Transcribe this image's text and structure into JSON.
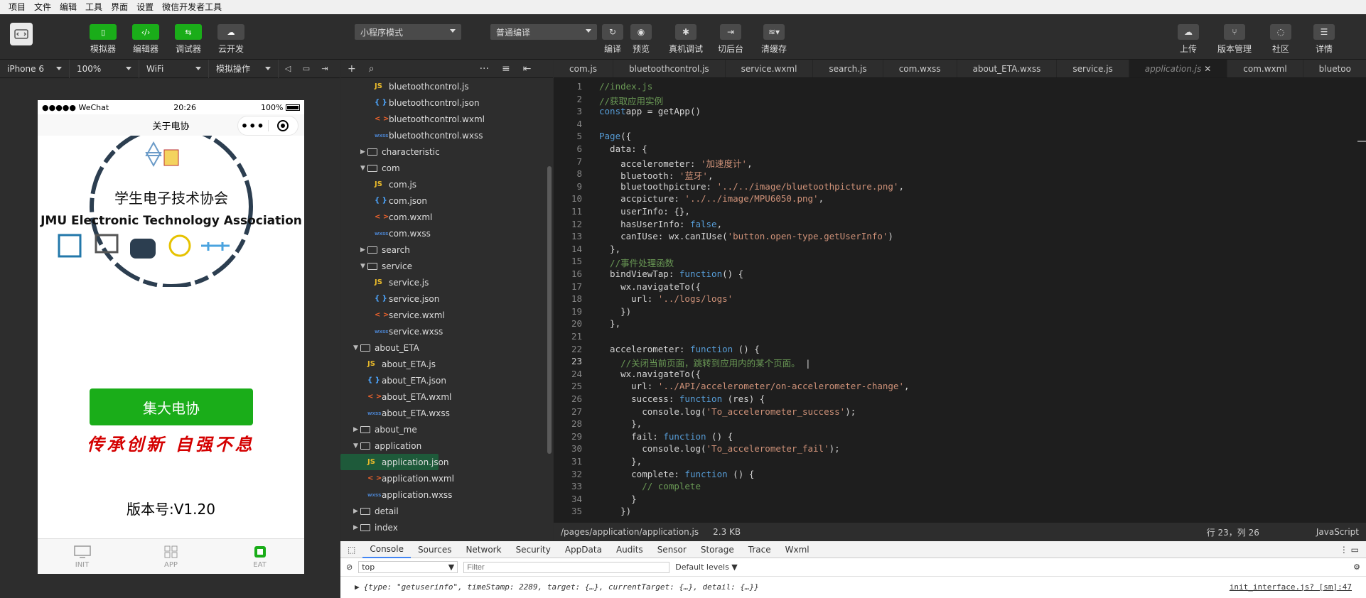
{
  "menu": [
    "项目",
    "文件",
    "编辑",
    "工具",
    "界面",
    "设置",
    "微信开发者工具"
  ],
  "toolbar": {
    "buttons": [
      {
        "label": "模拟器",
        "icon": "phone-icon"
      },
      {
        "label": "编辑器",
        "icon": "code-icon"
      },
      {
        "label": "调试器",
        "icon": "debug-icon"
      },
      {
        "label": "云开发",
        "icon": "cloud-icon"
      }
    ],
    "mode_select": "小程序模式",
    "compile_select": "普通编译",
    "actions": [
      "编译",
      "预览",
      "真机调试",
      "切后台",
      "清缓存"
    ],
    "right": [
      "上传",
      "版本管理",
      "社区",
      "详情"
    ]
  },
  "simbar": {
    "device": "iPhone 6",
    "zoom": "100%",
    "network": "WiFi",
    "op": "模拟操作"
  },
  "phone": {
    "carrier": "●●●●● WeChat",
    "time": "20:26",
    "battery": "100%",
    "nav_title": "关于电协",
    "logo_cn": "学生电子技术协会",
    "logo_en": "JMU  Electronic Technology Association",
    "main_button": "集大电协",
    "slogan": "传承创新 自强不息",
    "version": "版本号:V1.20",
    "tabs": [
      {
        "label": "INIT"
      },
      {
        "label": "APP"
      },
      {
        "label": "EAT"
      }
    ]
  },
  "tree": [
    {
      "t": "js",
      "name": "bluetoothcontrol.js",
      "d": 2
    },
    {
      "t": "json",
      "name": "bluetoothcontrol.json",
      "d": 2
    },
    {
      "t": "wxml",
      "name": "bluetoothcontrol.wxml",
      "d": 2
    },
    {
      "t": "wxss",
      "name": "bluetoothcontrol.wxss",
      "d": 2
    },
    {
      "t": "folder",
      "name": "characteristic",
      "d": 1,
      "open": false
    },
    {
      "t": "folder",
      "name": "com",
      "d": 1,
      "open": true
    },
    {
      "t": "js",
      "name": "com.js",
      "d": 2
    },
    {
      "t": "json",
      "name": "com.json",
      "d": 2
    },
    {
      "t": "wxml",
      "name": "com.wxml",
      "d": 2
    },
    {
      "t": "wxss",
      "name": "com.wxss",
      "d": 2
    },
    {
      "t": "folder",
      "name": "search",
      "d": 1,
      "open": false
    },
    {
      "t": "folder",
      "name": "service",
      "d": 1,
      "open": true
    },
    {
      "t": "js",
      "name": "service.js",
      "d": 2
    },
    {
      "t": "json",
      "name": "service.json",
      "d": 2
    },
    {
      "t": "wxml",
      "name": "service.wxml",
      "d": 2
    },
    {
      "t": "wxss",
      "name": "service.wxss",
      "d": 2
    },
    {
      "t": "folder",
      "name": "about_ETA",
      "d": 0,
      "open": true
    },
    {
      "t": "js",
      "name": "about_ETA.js",
      "d": 1
    },
    {
      "t": "json",
      "name": "about_ETA.json",
      "d": 1
    },
    {
      "t": "wxml",
      "name": "about_ETA.wxml",
      "d": 1
    },
    {
      "t": "wxss",
      "name": "about_ETA.wxss",
      "d": 1
    },
    {
      "t": "folder",
      "name": "about_me",
      "d": 0,
      "open": false
    },
    {
      "t": "folder",
      "name": "application",
      "d": 0,
      "open": true
    },
    {
      "t": "js",
      "name": "application.js",
      "d": 1,
      "sel": true
    },
    {
      "t": "json",
      "name": "application.json",
      "d": 1
    },
    {
      "t": "wxml",
      "name": "application.wxml",
      "d": 1
    },
    {
      "t": "wxss",
      "name": "application.wxss",
      "d": 1
    },
    {
      "t": "folder",
      "name": "detail",
      "d": 0,
      "open": false
    },
    {
      "t": "folder",
      "name": "index",
      "d": 0,
      "open": false
    }
  ],
  "icons": {
    "js": "JS",
    "json": "{ }",
    "wxml": "< >",
    "wxss": "wxss"
  },
  "editor_tabs": [
    "com.js",
    "bluetoothcontrol.js",
    "service.wxml",
    "search.js",
    "com.wxss",
    "about_ETA.wxss",
    "service.js",
    "application.js",
    "com.wxml",
    "bluetoo"
  ],
  "active_tab": "application.js",
  "code": [
    [
      [
        "c-com",
        "//index.js"
      ]
    ],
    [
      [
        "c-com",
        "//获取应用实例"
      ]
    ],
    [
      [
        "c-kw",
        "const"
      ],
      [
        "",
        "app = getApp()"
      ]
    ],
    [],
    [
      [
        "c-kw",
        "Page"
      ],
      [
        "",
        "({"
      ]
    ],
    [
      [
        "",
        "  data: {"
      ]
    ],
    [
      [
        "",
        "    accelerometer: "
      ],
      [
        "c-str",
        "'加速度计'"
      ],
      [
        "",
        ","
      ]
    ],
    [
      [
        "",
        "    bluetooth: "
      ],
      [
        "c-str",
        "'蓝牙'"
      ],
      [
        "",
        ","
      ]
    ],
    [
      [
        "",
        "    bluetoothpicture: "
      ],
      [
        "c-str",
        "'../../image/bluetoothpicture.png'"
      ],
      [
        "",
        ","
      ]
    ],
    [
      [
        "",
        "    accpicture: "
      ],
      [
        "c-str",
        "'../../image/MPU6050.png'"
      ],
      [
        "",
        ","
      ]
    ],
    [
      [
        "",
        "    userInfo: {},"
      ]
    ],
    [
      [
        "",
        "    hasUserInfo: "
      ],
      [
        "c-kw",
        "false"
      ],
      [
        "",
        ","
      ]
    ],
    [
      [
        "",
        "    canIUse: wx.canIUse("
      ],
      [
        "c-str",
        "'button.open-type.getUserInfo'"
      ],
      [
        "",
        ")"
      ]
    ],
    [
      [
        "",
        "  },"
      ]
    ],
    [
      [
        "c-com",
        "  //事件处理函数"
      ]
    ],
    [
      [
        "",
        "  bindViewTap: "
      ],
      [
        "c-kw",
        "function"
      ],
      [
        "",
        "() {"
      ]
    ],
    [
      [
        "",
        "    wx.navigateTo({"
      ]
    ],
    [
      [
        "",
        "      url: "
      ],
      [
        "c-str",
        "'../logs/logs'"
      ]
    ],
    [
      [
        "",
        "    })"
      ]
    ],
    [
      [
        "",
        "  },"
      ]
    ],
    [],
    [
      [
        "",
        "  accelerometer: "
      ],
      [
        "c-kw",
        "function"
      ],
      [
        "",
        " () {"
      ]
    ],
    [
      [
        "c-com",
        "    //关闭当前页面，跳转到应用内的某个页面。"
      ],
      [
        "",
        " |"
      ]
    ],
    [
      [
        "",
        "    wx.navigateTo({"
      ]
    ],
    [
      [
        "",
        "      url: "
      ],
      [
        "c-str",
        "'../API/accelerometer/on-accelerometer-change'"
      ],
      [
        "",
        ","
      ]
    ],
    [
      [
        "",
        "      success: "
      ],
      [
        "c-kw",
        "function"
      ],
      [
        "",
        " (res) {"
      ]
    ],
    [
      [
        "",
        "        console.log("
      ],
      [
        "c-str",
        "'To_accelerometer_success'"
      ],
      [
        "",
        ");"
      ]
    ],
    [
      [
        "",
        "      },"
      ]
    ],
    [
      [
        "",
        "      fail: "
      ],
      [
        "c-kw",
        "function"
      ],
      [
        "",
        " () {"
      ]
    ],
    [
      [
        "",
        "        console.log("
      ],
      [
        "c-str",
        "'To_accelerometer_fail'"
      ],
      [
        "",
        ");"
      ]
    ],
    [
      [
        "",
        "      },"
      ]
    ],
    [
      [
        "",
        "      complete: "
      ],
      [
        "c-kw",
        "function"
      ],
      [
        "",
        " () {"
      ]
    ],
    [
      [
        "c-com",
        "        // complete"
      ]
    ],
    [
      [
        "",
        "      }"
      ]
    ],
    [
      [
        "",
        "    })"
      ]
    ]
  ],
  "editor_status": {
    "path": "/pages/application/application.js",
    "size": "2.3 KB",
    "pos": "行 23，列 26",
    "lang": "JavaScript"
  },
  "devtools": {
    "tabs": [
      "Console",
      "Sources",
      "Network",
      "Security",
      "AppData",
      "Audits",
      "Sensor",
      "Storage",
      "Trace",
      "Wxml"
    ],
    "context": "top",
    "filter_placeholder": "Filter",
    "levels": "Default levels ▼",
    "log": "{type: \"getuserinfo\", timeStamp: 2289, target: {…}, currentTarget: {…}, detail: {…}}",
    "log_src": "init_interface.js? [sm]:47"
  }
}
